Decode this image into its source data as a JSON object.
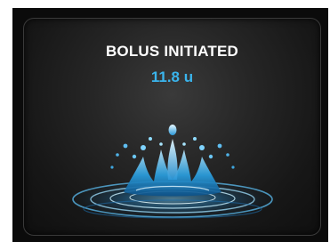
{
  "notification": {
    "title": "BOLUS INITIATED",
    "amount": "11.8 u",
    "illustration_icon": "water-drop-splash-icon"
  },
  "colors": {
    "background": "#1a1a1a",
    "title_text": "#ffffff",
    "amount_text": "#3ab4ec",
    "splash_accent": "#2aa8e6"
  }
}
